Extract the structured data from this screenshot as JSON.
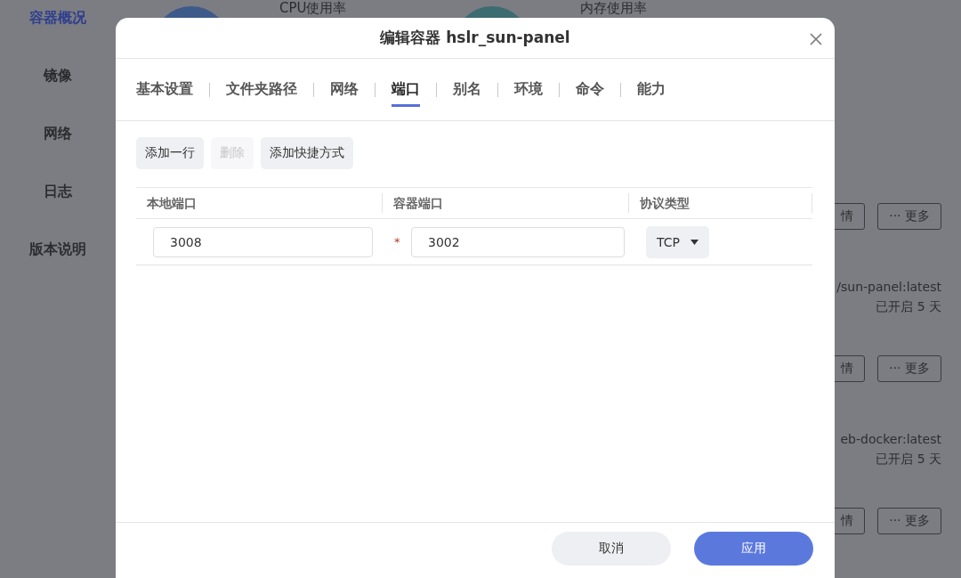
{
  "sidebar": {
    "items": [
      {
        "label": "容器概况",
        "selected": true
      },
      {
        "label": "镜像",
        "selected": false
      },
      {
        "label": "网络",
        "selected": false
      },
      {
        "label": "日志",
        "selected": false
      },
      {
        "label": "版本说明",
        "selected": false
      }
    ]
  },
  "stats": [
    {
      "label": "CPU使用率",
      "color": "#3e5a8a"
    },
    {
      "label": "内存使用率",
      "color": "#3d6b72"
    }
  ],
  "container_cards": [
    {
      "actions": [
        "情",
        "··· 更多"
      ]
    },
    {
      "image": "/sun-panel:latest",
      "uptime": "已开启 5 天",
      "actions": [
        "情",
        "··· 更多"
      ]
    },
    {
      "image": "eb-docker:latest",
      "uptime": "已开启 5 天",
      "actions": [
        "情",
        "··· 更多"
      ]
    }
  ],
  "dialog": {
    "title": "编辑容器 hslr_sun-panel",
    "tabs": [
      {
        "label": "基本设置",
        "selected": false
      },
      {
        "label": "文件夹路径",
        "selected": false
      },
      {
        "label": "网络",
        "selected": false
      },
      {
        "label": "端口",
        "selected": true
      },
      {
        "label": "别名",
        "selected": false
      },
      {
        "label": "环境",
        "selected": false
      },
      {
        "label": "命令",
        "selected": false
      },
      {
        "label": "能力",
        "selected": false
      }
    ],
    "toolbar": [
      {
        "label": "添加一行",
        "disabled": false
      },
      {
        "label": "删除",
        "disabled": true
      },
      {
        "label": "添加快捷方式",
        "disabled": false
      }
    ],
    "table": {
      "columns": [
        "本地端口",
        "容器端口",
        "协议类型"
      ],
      "rows": [
        {
          "local_port": "3008",
          "required_mark": "*",
          "container_port": "3002",
          "protocol": "TCP"
        }
      ]
    },
    "footer": [
      {
        "label": "取消",
        "kind": "secondary"
      },
      {
        "label": "应用",
        "kind": "primary"
      }
    ]
  }
}
